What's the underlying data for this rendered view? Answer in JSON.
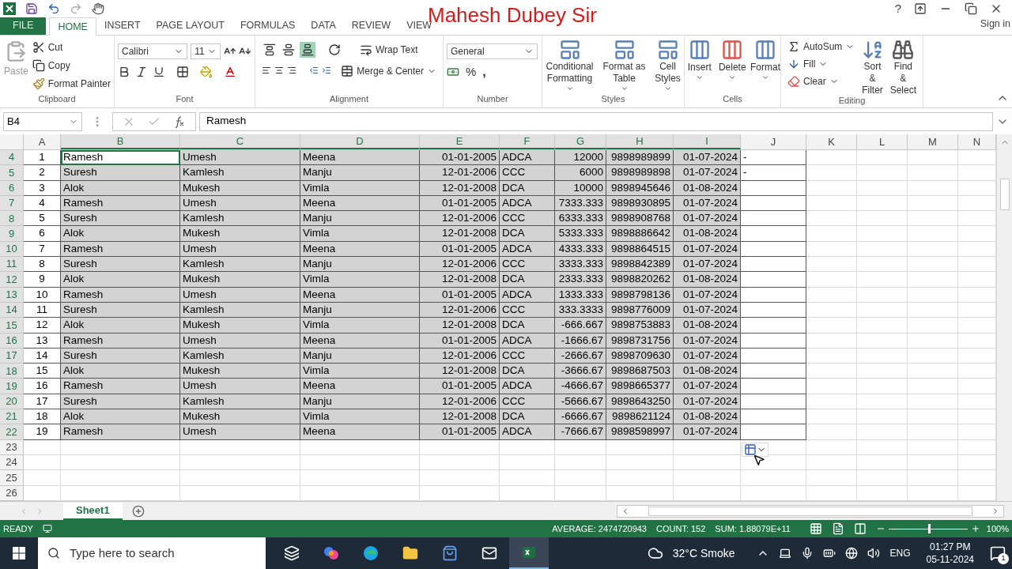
{
  "title": "Mahesh Dubey Sir",
  "window": {
    "help": "?",
    "sign_in": "Sign in"
  },
  "tabs": [
    {
      "label": "FILE",
      "kind": "file",
      "selected": false
    },
    {
      "label": "HOME",
      "kind": "tab",
      "selected": true
    },
    {
      "label": "INSERT",
      "kind": "tab",
      "selected": false
    },
    {
      "label": "PAGE LAYOUT",
      "kind": "tab",
      "selected": false
    },
    {
      "label": "FORMULAS",
      "kind": "tab",
      "selected": false
    },
    {
      "label": "DATA",
      "kind": "tab",
      "selected": false
    },
    {
      "label": "REVIEW",
      "kind": "tab",
      "selected": false
    },
    {
      "label": "VIEW",
      "kind": "tab",
      "selected": false
    }
  ],
  "ribbon": {
    "clipboard": {
      "label": "Clipboard",
      "paste": "Paste",
      "cut": "Cut",
      "copy": "Copy",
      "format_painter": "Format Painter"
    },
    "font": {
      "label": "Font",
      "name": "Calibri",
      "size": "11"
    },
    "alignment": {
      "label": "Alignment",
      "wrap_text": "Wrap Text",
      "merge": "Merge & Center",
      "vertical_align": [
        {
          "selected": false
        },
        {
          "selected": false
        },
        {
          "selected": true
        }
      ]
    },
    "number": {
      "label": "Number",
      "format": "General",
      "percent": "%",
      "comma": ","
    },
    "styles": {
      "label": "Styles",
      "buttons": [
        "Conditional Formatting",
        "Format as Table",
        "Cell Styles"
      ]
    },
    "cells": {
      "label": "Cells",
      "buttons": [
        "Insert",
        "Delete",
        "Format"
      ]
    },
    "editing": {
      "label": "Editing",
      "autosum": "AutoSum",
      "fill": "Fill",
      "clear": "Clear",
      "sort_filter": "Sort & Filter",
      "find_select": "Find & Select"
    }
  },
  "formula_bar": {
    "name_box": "B4",
    "value": "Ramesh"
  },
  "columns": [
    {
      "label": "A",
      "selected": false
    },
    {
      "label": "B",
      "selected": true
    },
    {
      "label": "C",
      "selected": true
    },
    {
      "label": "D",
      "selected": true
    },
    {
      "label": "E",
      "selected": true
    },
    {
      "label": "F",
      "selected": true
    },
    {
      "label": "G",
      "selected": true
    },
    {
      "label": "H",
      "selected": true
    },
    {
      "label": "I",
      "selected": true
    },
    {
      "label": "J",
      "selected": false
    },
    {
      "label": "K",
      "selected": false
    },
    {
      "label": "L",
      "selected": false
    },
    {
      "label": "M",
      "selected": false
    },
    {
      "label": "N",
      "selected": false
    }
  ],
  "rows": [
    {
      "n": "4",
      "selected": true,
      "active": true,
      "cells": [
        "1",
        "Ramesh",
        "Umesh",
        "Meena",
        "01-01-2005",
        "ADCA",
        "12000",
        "9898989899",
        "01-07-2024"
      ],
      "extra": "-"
    },
    {
      "n": "5",
      "selected": true,
      "active": false,
      "cells": [
        "2",
        "Suresh",
        "Kamlesh",
        "Manju",
        "12-01-2006",
        "CCC",
        "6000",
        "9898989898",
        "01-07-2024"
      ],
      "extra": "-"
    },
    {
      "n": "6",
      "selected": true,
      "active": false,
      "cells": [
        "3",
        "Alok",
        "Mukesh",
        "Vimla",
        "12-01-2008",
        "DCA",
        "10000",
        "9898945646",
        "01-08-2024"
      ]
    },
    {
      "n": "7",
      "selected": true,
      "active": false,
      "cells": [
        "4",
        "Ramesh",
        "Umesh",
        "Meena",
        "01-01-2005",
        "ADCA",
        "7333.333",
        "9898930895",
        "01-07-2024"
      ]
    },
    {
      "n": "8",
      "selected": true,
      "active": false,
      "cells": [
        "5",
        "Suresh",
        "Kamlesh",
        "Manju",
        "12-01-2006",
        "CCC",
        "6333.333",
        "9898908768",
        "01-07-2024"
      ]
    },
    {
      "n": "9",
      "selected": true,
      "active": false,
      "cells": [
        "6",
        "Alok",
        "Mukesh",
        "Vimla",
        "12-01-2008",
        "DCA",
        "5333.333",
        "9898886642",
        "01-08-2024"
      ]
    },
    {
      "n": "10",
      "selected": true,
      "active": false,
      "cells": [
        "7",
        "Ramesh",
        "Umesh",
        "Meena",
        "01-01-2005",
        "ADCA",
        "4333.333",
        "9898864515",
        "01-07-2024"
      ]
    },
    {
      "n": "11",
      "selected": true,
      "active": false,
      "cells": [
        "8",
        "Suresh",
        "Kamlesh",
        "Manju",
        "12-01-2006",
        "CCC",
        "3333.333",
        "9898842389",
        "01-07-2024"
      ]
    },
    {
      "n": "12",
      "selected": true,
      "active": false,
      "cells": [
        "9",
        "Alok",
        "Mukesh",
        "Vimla",
        "12-01-2008",
        "DCA",
        "2333.333",
        "9898820262",
        "01-08-2024"
      ]
    },
    {
      "n": "13",
      "selected": true,
      "active": false,
      "cells": [
        "10",
        "Ramesh",
        "Umesh",
        "Meena",
        "01-01-2005",
        "ADCA",
        "1333.333",
        "9898798136",
        "01-07-2024"
      ]
    },
    {
      "n": "14",
      "selected": true,
      "active": false,
      "cells": [
        "11",
        "Suresh",
        "Kamlesh",
        "Manju",
        "12-01-2006",
        "CCC",
        "333.3333",
        "9898776009",
        "01-07-2024"
      ]
    },
    {
      "n": "15",
      "selected": true,
      "active": false,
      "cells": [
        "12",
        "Alok",
        "Mukesh",
        "Vimla",
        "12-01-2008",
        "DCA",
        "-666.667",
        "9898753883",
        "01-08-2024"
      ]
    },
    {
      "n": "16",
      "selected": true,
      "active": false,
      "cells": [
        "13",
        "Ramesh",
        "Umesh",
        "Meena",
        "01-01-2005",
        "ADCA",
        "-1666.67",
        "9898731756",
        "01-07-2024"
      ]
    },
    {
      "n": "17",
      "selected": true,
      "active": false,
      "cells": [
        "14",
        "Suresh",
        "Kamlesh",
        "Manju",
        "12-01-2006",
        "CCC",
        "-2666.67",
        "9898709630",
        "01-07-2024"
      ]
    },
    {
      "n": "18",
      "selected": true,
      "active": false,
      "cells": [
        "15",
        "Alok",
        "Mukesh",
        "Vimla",
        "12-01-2008",
        "DCA",
        "-3666.67",
        "9898687503",
        "01-08-2024"
      ]
    },
    {
      "n": "19",
      "selected": true,
      "active": false,
      "cells": [
        "16",
        "Ramesh",
        "Umesh",
        "Meena",
        "01-01-2005",
        "ADCA",
        "-4666.67",
        "9898665377",
        "01-07-2024"
      ]
    },
    {
      "n": "20",
      "selected": true,
      "active": false,
      "cells": [
        "17",
        "Suresh",
        "Kamlesh",
        "Manju",
        "12-01-2006",
        "CCC",
        "-5666.67",
        "9898643250",
        "01-07-2024"
      ]
    },
    {
      "n": "21",
      "selected": true,
      "active": false,
      "cells": [
        "18",
        "Alok",
        "Mukesh",
        "Vimla",
        "12-01-2008",
        "DCA",
        "-6666.67",
        "9898621124",
        "01-08-2024"
      ]
    },
    {
      "n": "22",
      "selected": true,
      "active": false,
      "cells": [
        "19",
        "Ramesh",
        "Umesh",
        "Meena",
        "01-01-2005",
        "ADCA",
        "-7666.67",
        "9898598997",
        "01-07-2024"
      ]
    },
    {
      "n": "23",
      "selected": false,
      "active": false
    },
    {
      "n": "24",
      "selected": false,
      "active": false
    },
    {
      "n": "25",
      "selected": false,
      "active": false
    },
    {
      "n": "26",
      "selected": false,
      "active": false
    }
  ],
  "sheets": [
    {
      "label": "Sheet1",
      "selected": true
    }
  ],
  "status_bar": {
    "mode": "READY",
    "average": "AVERAGE: 2474720943",
    "count": "COUNT: 152",
    "sum": "SUM: 1.88079E+11",
    "zoom": "100%",
    "zoom_level": {
      "level": 0.5
    }
  },
  "taskbar": {
    "search_placeholder": "Type here to search",
    "apps": [
      {
        "kind": "task_view",
        "selected": false
      },
      {
        "kind": "copilot",
        "selected": false
      },
      {
        "kind": "edge",
        "selected": false
      },
      {
        "kind": "explorer",
        "selected": false
      },
      {
        "kind": "store",
        "selected": false
      },
      {
        "kind": "mail",
        "selected": false
      },
      {
        "kind": "excel",
        "selected": true
      }
    ],
    "weather": "32°C Smoke",
    "language": "ENG",
    "time": "01:27 PM",
    "date": "05-11-2024",
    "notifications": "1"
  }
}
